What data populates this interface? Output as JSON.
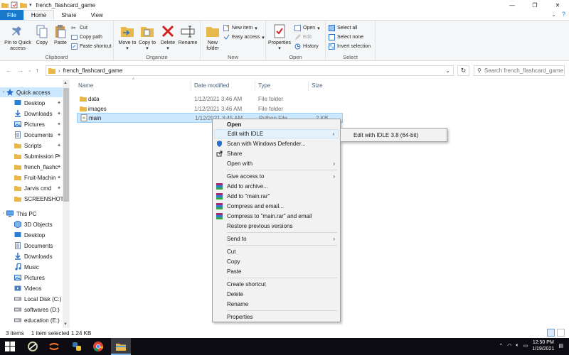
{
  "window": {
    "title": "french_flashcard_game",
    "controls": [
      "—",
      "❐",
      "✕"
    ]
  },
  "tabs": [
    "File",
    "Home",
    "Share",
    "View"
  ],
  "ribbon": {
    "clipboard": {
      "label": "Clipboard",
      "pin": "Pin to Quick access",
      "copy": "Copy",
      "paste": "Paste",
      "cut": "Cut",
      "copy_path": "Copy path",
      "paste_shortcut": "Paste shortcut"
    },
    "organize": {
      "label": "Organize",
      "move_to": "Move to",
      "copy_to": "Copy to",
      "delete": "Delete",
      "rename": "Rename"
    },
    "new": {
      "label": "New",
      "new_folder": "New folder",
      "new_item": "New item",
      "easy_access": "Easy access"
    },
    "open": {
      "label": "Open",
      "properties": "Properties",
      "open": "Open",
      "edit": "Edit",
      "history": "History"
    },
    "select": {
      "label": "Select",
      "select_all": "Select all",
      "select_none": "Select none",
      "invert": "Invert selection"
    }
  },
  "address": {
    "path": "french_flashcard_game",
    "search_placeholder": "Search french_flashcard_game"
  },
  "nav": {
    "quick_access": "Quick access",
    "quick_items": [
      "Desktop",
      "Downloads",
      "Pictures",
      "Documents",
      "Scripts",
      "Submission P",
      "french_flashc",
      "Fruit-Machin",
      "Jarvis cmd",
      "SCREENSHOTS"
    ],
    "this_pc": "This PC",
    "pc_items": [
      "3D Objects",
      "Desktop",
      "Documents",
      "Downloads",
      "Music",
      "Pictures",
      "Videos",
      "Local Disk (C:)",
      "softwares (D:)",
      "education (E:)"
    ]
  },
  "columns": {
    "name": "Name",
    "date": "Date modified",
    "type": "Type",
    "size": "Size"
  },
  "files": [
    {
      "name": "data",
      "date": "1/12/2021 3:46 AM",
      "type": "File folder",
      "size": ""
    },
    {
      "name": "images",
      "date": "1/12/2021 3:46 AM",
      "type": "File folder",
      "size": ""
    },
    {
      "name": "main",
      "date": "1/12/2021 3:45 AM",
      "type": "Python File",
      "size": "2 KB"
    }
  ],
  "context_menu": {
    "open": "Open",
    "edit_idle": "Edit with IDLE",
    "defender": "Scan with Windows Defender...",
    "share": "Share",
    "open_with": "Open with",
    "give_access": "Give access to",
    "add_archive": "Add to archive...",
    "add_rar": "Add to \"main.rar\"",
    "compress_email": "Compress and email...",
    "compress_rar_email": "Compress to \"main.rar\" and email",
    "restore": "Restore previous versions",
    "send_to": "Send to",
    "cut": "Cut",
    "copy": "Copy",
    "paste": "Paste",
    "create_shortcut": "Create shortcut",
    "delete": "Delete",
    "rename": "Rename",
    "properties": "Properties"
  },
  "submenu": {
    "edit_idle_38": "Edit with IDLE 3.8 (64-bit)"
  },
  "status": {
    "items": "3 items",
    "selected": "1 item selected  1.24 KB"
  },
  "taskbar": {
    "time": "12:50 PM",
    "date": "1/19/2021"
  },
  "colors": {
    "accent": "#1979ca",
    "selection": "#cce8ff",
    "folder": "#e8b94a",
    "taskbar": "#0c0c12"
  }
}
